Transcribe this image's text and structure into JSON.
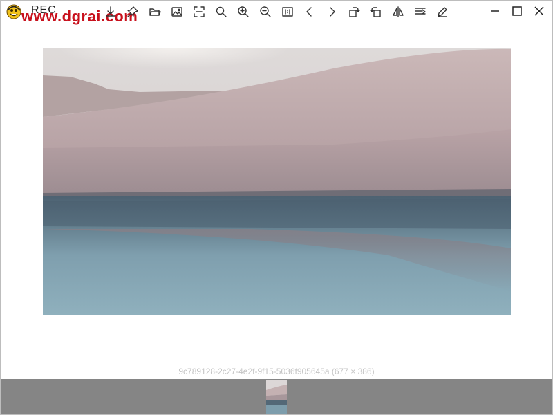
{
  "app": {
    "title_text": "REC",
    "watermark": "www.dgrai.com",
    "icon": "app-logo-icon"
  },
  "toolbar": {
    "tools": [
      {
        "name": "download-icon",
        "label": "Save"
      },
      {
        "name": "pin-icon",
        "label": "Pin"
      },
      {
        "name": "folder-open-icon",
        "label": "Open"
      },
      {
        "name": "image-icon",
        "label": "Image"
      },
      {
        "name": "fit-screen-icon",
        "label": "Fit"
      },
      {
        "name": "search-icon",
        "label": "Search"
      },
      {
        "name": "zoom-in-icon",
        "label": "Zoom in"
      },
      {
        "name": "zoom-out-icon",
        "label": "Zoom out"
      },
      {
        "name": "actual-size-icon",
        "label": "1:1"
      },
      {
        "name": "previous-icon",
        "label": "Previous"
      },
      {
        "name": "next-icon",
        "label": "Next"
      },
      {
        "name": "rotate-right-icon",
        "label": "Rotate right"
      },
      {
        "name": "rotate-left-icon",
        "label": "Rotate left"
      },
      {
        "name": "flip-horizontal-icon",
        "label": "Flip"
      },
      {
        "name": "align-icon",
        "label": "Align"
      },
      {
        "name": "edit-icon",
        "label": "Edit"
      }
    ],
    "window_controls": [
      "minimize-icon",
      "maximize-icon",
      "close-icon"
    ]
  },
  "image": {
    "caption": "9c789128-2c27-4e2f-9f15-5036f905645a (677 × 386)",
    "colors": {
      "sky": "#d9d4d6",
      "dune_light": "#c7b4b4",
      "dune_mid": "#b29d9f",
      "dune_dark": "#8f8488",
      "water_dark": "#556a78",
      "water_light": "#8fb0be"
    }
  },
  "filmstrip": {
    "background": "#858585",
    "thumbnails": [
      {
        "selected": true
      }
    ]
  }
}
